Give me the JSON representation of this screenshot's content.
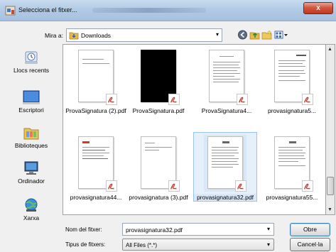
{
  "window": {
    "title": "Selecciona el fitxer...",
    "close_label": "x"
  },
  "toolbar": {
    "look_in_label": "Mira a:",
    "look_in_value": "Downloads"
  },
  "places": [
    {
      "label": "Llocs recents"
    },
    {
      "label": "Escriptori"
    },
    {
      "label": "Biblioteques"
    },
    {
      "label": "Ordinador"
    },
    {
      "label": "Xarxa"
    }
  ],
  "files": [
    {
      "name": "ProvaSignatura (2).pdf"
    },
    {
      "name": "ProvaSignatura.pdf"
    },
    {
      "name": "ProvaSignatura4..."
    },
    {
      "name": "provasignatura5..."
    },
    {
      "name": "provasignatura44..."
    },
    {
      "name": "provasignatura (3).pdf"
    },
    {
      "name": "provasignatura32.pdf"
    },
    {
      "name": "provasignatura55..."
    }
  ],
  "form": {
    "file_name_label": "Nom del fitxer:",
    "file_name_value": "provasignatura32.pdf",
    "file_type_label": "Tipus de fitxers:",
    "file_type_value": "All Files (*.*)"
  },
  "buttons": {
    "open": "Obre",
    "cancel": "Cancel·la"
  },
  "colors": {
    "title_gradient": "#b2cbe6",
    "close_button": "#c2381f",
    "selection": "#d9e8f8",
    "pdf_red": "#d23b2a"
  }
}
